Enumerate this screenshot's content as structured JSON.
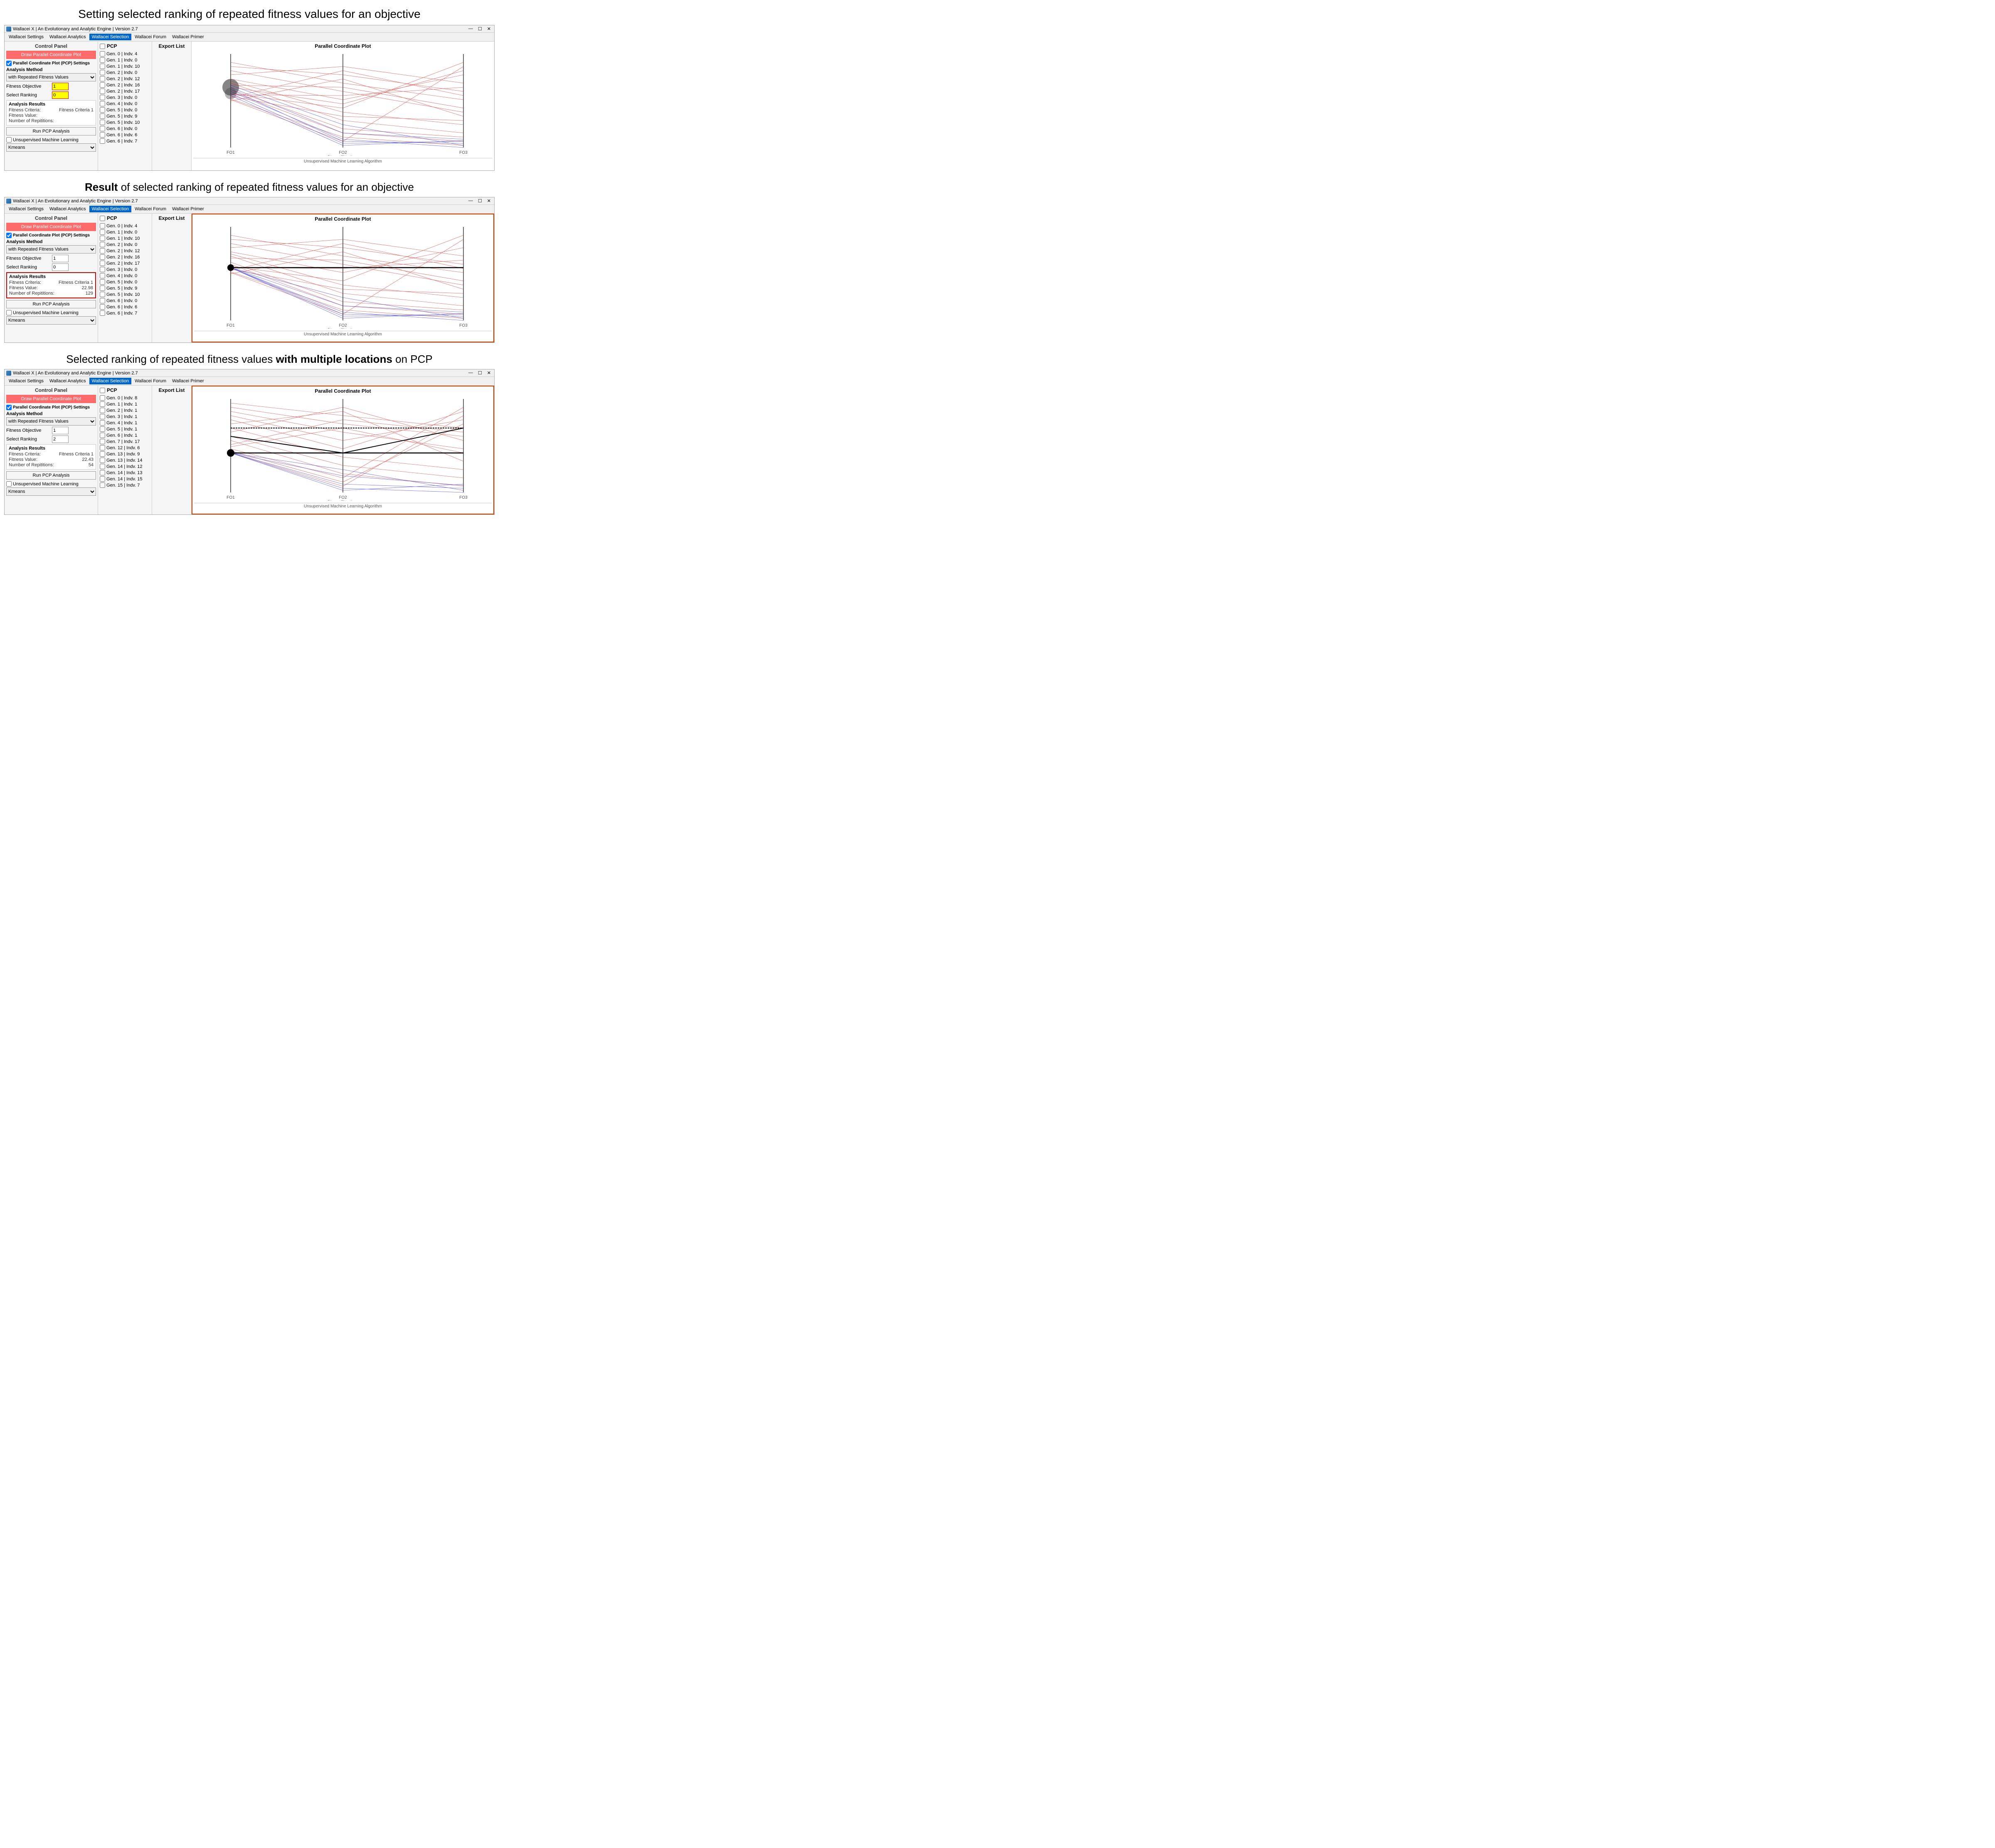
{
  "sections": [
    {
      "title": "Setting selected ranking of repeated fitness values for an objective",
      "title_type": "normal"
    },
    {
      "title": "Result of selected ranking of repeated fitness values for an objective",
      "title_type": "result",
      "bold_word": "Result"
    },
    {
      "title": "Selected ranking of repeated fitness values with multiple locations on PCP",
      "title_type": "multiple",
      "bold_phrase": "with multiple locations"
    }
  ],
  "app": {
    "title": "Wallacei X  |  An Evolutionary and Analytic Engine  |  Version 2.7",
    "menus": [
      "Wallacei Settings",
      "Wallacei Analytics",
      "Wallacei Selection",
      "Wallacei Forum",
      "Wallacei Primer"
    ],
    "active_menu": "Wallacei Selection"
  },
  "windows": [
    {
      "id": "window1",
      "control_panel": {
        "title": "Control Panel",
        "draw_btn": "Draw Parallel Coordinate Plot",
        "pcp_checkbox": true,
        "pcp_label": "Parallel Coordinate Plot (PCP) Settings",
        "analysis_method_label": "Analysis Method",
        "analysis_method_value": "with Repeated Fitness Values",
        "fitness_objective_label": "Fitness Objective",
        "fitness_objective_value": "1",
        "fitness_objective_highlighted": true,
        "select_ranking_label": "Select Ranking",
        "select_ranking_value": "0",
        "select_ranking_highlighted": true,
        "results": {
          "title": "Analysis Results",
          "highlighted": false,
          "fitness_criteria_label": "Fitness Criteria:",
          "fitness_criteria_value": "Fitness Criteria 1",
          "fitness_value_label": "Fitness Value:",
          "fitness_value_value": "",
          "repetitions_label": "Number of Repititions:",
          "repetitions_value": ""
        },
        "run_btn": "Run PCP Analysis",
        "unsupervised_label": "Unsupervised Machine Learning",
        "kmeans_value": "Kmeans"
      },
      "pcp_items": [
        "Gen. 0 | Indv. 4",
        "Gen. 1 | Indv. 0",
        "Gen. 1 | Indv. 10",
        "Gen. 2 | Indv. 0",
        "Gen. 2 | Indv. 12",
        "Gen. 2 | Indv. 16",
        "Gen. 2 | Indv. 17",
        "Gen. 3 | Indv. 0",
        "Gen. 4 | Indv. 0",
        "Gen. 5 | Indv. 0",
        "Gen. 5 | Indv. 9",
        "Gen. 5 | Indv. 10",
        "Gen. 6 | Indv. 0",
        "Gen. 6 | Indv. 6",
        "Gen. 6 | Indv. 7"
      ],
      "plot": {
        "title": "Parallel Coordinate Plot",
        "axes": [
          "FO1",
          "FO2\nFitness Objectives",
          "FO3"
        ],
        "bottom_label": "Unsupervised Machine Learning Algorithm",
        "has_dot": false
      }
    },
    {
      "id": "window2",
      "control_panel": {
        "title": "Control Panel",
        "draw_btn": "Draw Parallel Coordinate Plot",
        "pcp_checkbox": true,
        "pcp_label": "Parallel Coordinate Plot (PCP) Settings",
        "analysis_method_label": "Analysis Method",
        "analysis_method_value": "with Repeated Fitness Values",
        "fitness_objective_label": "Fitness Objective",
        "fitness_objective_value": "1",
        "fitness_objective_highlighted": false,
        "select_ranking_label": "Select Ranking",
        "select_ranking_value": "0",
        "select_ranking_highlighted": false,
        "results": {
          "title": "Analysis Results",
          "highlighted": true,
          "fitness_criteria_label": "Fitness Criteria:",
          "fitness_criteria_value": "Fitness Criteria 1",
          "fitness_value_label": "Fitness Value:",
          "fitness_value_value": "22.98",
          "repetitions_label": "Number of Repititions:",
          "repetitions_value": "129"
        },
        "run_btn": "Run PCP Analysis",
        "unsupervised_label": "Unsupervised Machine Learning",
        "kmeans_value": "Kmeans"
      },
      "pcp_items": [
        "Gen. 0 | Indv. 4",
        "Gen. 1 | Indv. 0",
        "Gen. 1 | Indv. 10",
        "Gen. 2 | Indv. 0",
        "Gen. 2 | Indv. 12",
        "Gen. 2 | Indv. 16",
        "Gen. 2 | Indv. 17",
        "Gen. 3 | Indv. 0",
        "Gen. 4 | Indv. 0",
        "Gen. 5 | Indv. 0",
        "Gen. 5 | Indv. 9",
        "Gen. 5 | Indv. 10",
        "Gen. 6 | Indv. 0",
        "Gen. 6 | Indv. 6",
        "Gen. 6 | Indv. 7"
      ],
      "plot": {
        "title": "Parallel Coordinate Plot",
        "axes": [
          "FO1",
          "FO2\nFitness Objectives",
          "FO3"
        ],
        "bottom_label": "Unsupervised Machine Learning Algorithm",
        "has_dot": true,
        "dot_y": 0.42
      }
    },
    {
      "id": "window3",
      "control_panel": {
        "title": "Control Panel",
        "draw_btn": "Draw Parallel Coordinate Plot",
        "pcp_checkbox": true,
        "pcp_label": "Parallel Coordinate Plot (PCP) Settings",
        "analysis_method_label": "Analysis Method",
        "analysis_method_value": "with Repeated Fitness Values",
        "fitness_objective_label": "Fitness Objective",
        "fitness_objective_value": "1",
        "fitness_objective_highlighted": false,
        "select_ranking_label": "Select Ranking",
        "select_ranking_value": "2",
        "select_ranking_highlighted": false,
        "results": {
          "title": "Analysis Results",
          "highlighted": false,
          "fitness_criteria_label": "Fitness Criteria:",
          "fitness_criteria_value": "Fitness Criteria 1",
          "fitness_value_label": "Fitness Value:",
          "fitness_value_value": "22.43",
          "repetitions_label": "Number of Repititions:",
          "repetitions_value": "54"
        },
        "run_btn": "Run PCP Analysis",
        "unsupervised_label": "Unsupervised Machine Learning",
        "kmeans_value": "Kmeans"
      },
      "pcp_items": [
        "Gen. 0 | Indv. 8",
        "Gen. 1 | Indv. 1",
        "Gen. 2 | Indv. 1",
        "Gen. 3 | Indv. 1",
        "Gen. 4 | Indv. 1",
        "Gen. 5 | Indv. 1",
        "Gen. 6 | Indv. 1",
        "Gen. 7 | Indv. 17",
        "Gen. 12 | Indv. 6",
        "Gen. 13 | Indv. 9",
        "Gen. 13 | Indv. 14",
        "Gen. 14 | Indv. 12",
        "Gen. 14 | Indv. 13",
        "Gen. 14 | Indv. 15",
        "Gen. 15 | Indv. 7"
      ],
      "plot": {
        "title": "Parallel Coordinate Plot",
        "axes": [
          "FO1",
          "FO2\nFitness Objectives",
          "FO3"
        ],
        "bottom_label": "Unsupervised Machine Learning Algorithm",
        "has_dot": true,
        "dot_y": 0.55
      }
    }
  ],
  "labels": {
    "control_panel": "Control Panel",
    "export_list": "Export List",
    "pcp": "PCP"
  }
}
